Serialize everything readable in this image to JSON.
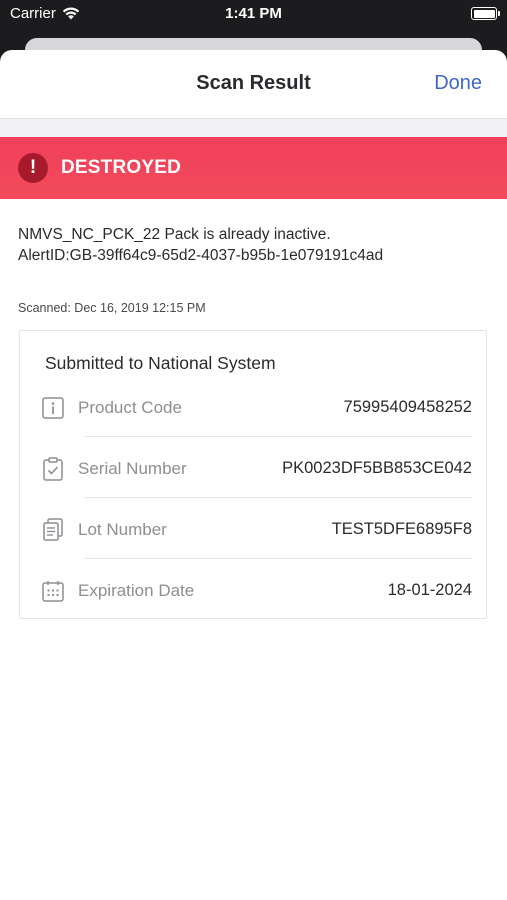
{
  "status_bar": {
    "carrier": "Carrier",
    "time": "1:41 PM"
  },
  "nav": {
    "title": "Scan Result",
    "done_label": "Done"
  },
  "banner": {
    "status": "DESTROYED",
    "icon": "exclamation-icon",
    "color": "#f0405a"
  },
  "message": {
    "line1": "NMVS_NC_PCK_22 Pack is already inactive.",
    "line2": "AlertID:GB-39ff64c9-65d2-4037-b95b-1e079191c4ad"
  },
  "scanned_text": "Scanned: Dec 16, 2019 12:15 PM",
  "card": {
    "title": "Submitted to National System",
    "rows": [
      {
        "icon": "info-icon",
        "label": "Product Code",
        "value": "75995409458252"
      },
      {
        "icon": "clipboard-check-icon",
        "label": "Serial Number",
        "value": "PK0023DF5BB853CE042"
      },
      {
        "icon": "documents-icon",
        "label": "Lot Number",
        "value": "TEST5DFE6895F8"
      },
      {
        "icon": "calendar-icon",
        "label": "Expiration Date",
        "value": "18-01-2024"
      }
    ]
  }
}
